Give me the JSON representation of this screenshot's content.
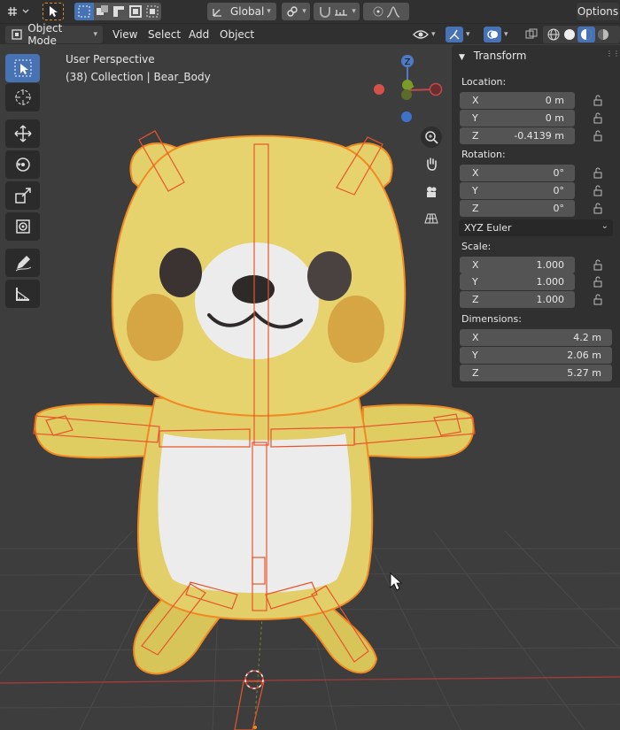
{
  "header": {
    "transform_orientation": "Global",
    "options_label": "Options"
  },
  "header2": {
    "mode": "Object Mode",
    "menus": [
      "View",
      "Select",
      "Add",
      "Object"
    ]
  },
  "viewport": {
    "perspective": "User Perspective",
    "collection_info": "(38) Collection | Bear_Body",
    "gizmo": {
      "z": "Z"
    }
  },
  "npanel": {
    "title": "Transform",
    "location": {
      "label": "Location:",
      "x": {
        "axis": "X",
        "value": "0 m"
      },
      "y": {
        "axis": "Y",
        "value": "0 m"
      },
      "z": {
        "axis": "Z",
        "value": "-0.4139 m"
      }
    },
    "rotation": {
      "label": "Rotation:",
      "x": {
        "axis": "X",
        "value": "0°"
      },
      "y": {
        "axis": "Y",
        "value": "0°"
      },
      "z": {
        "axis": "Z",
        "value": "0°"
      },
      "mode": "XYZ Euler"
    },
    "scale": {
      "label": "Scale:",
      "x": {
        "axis": "X",
        "value": "1.000"
      },
      "y": {
        "axis": "Y",
        "value": "1.000"
      },
      "z": {
        "axis": "Z",
        "value": "1.000"
      }
    },
    "dimensions": {
      "label": "Dimensions:",
      "x": {
        "axis": "X",
        "value": "4.2 m"
      },
      "y": {
        "axis": "Y",
        "value": "2.06 m"
      },
      "z": {
        "axis": "Z",
        "value": "5.27 m"
      }
    }
  },
  "colors": {
    "accent": "#4772b3",
    "selection_outline": "#f08a24",
    "bear_body": "#e2cf6a",
    "bear_belly": "#ececec"
  }
}
